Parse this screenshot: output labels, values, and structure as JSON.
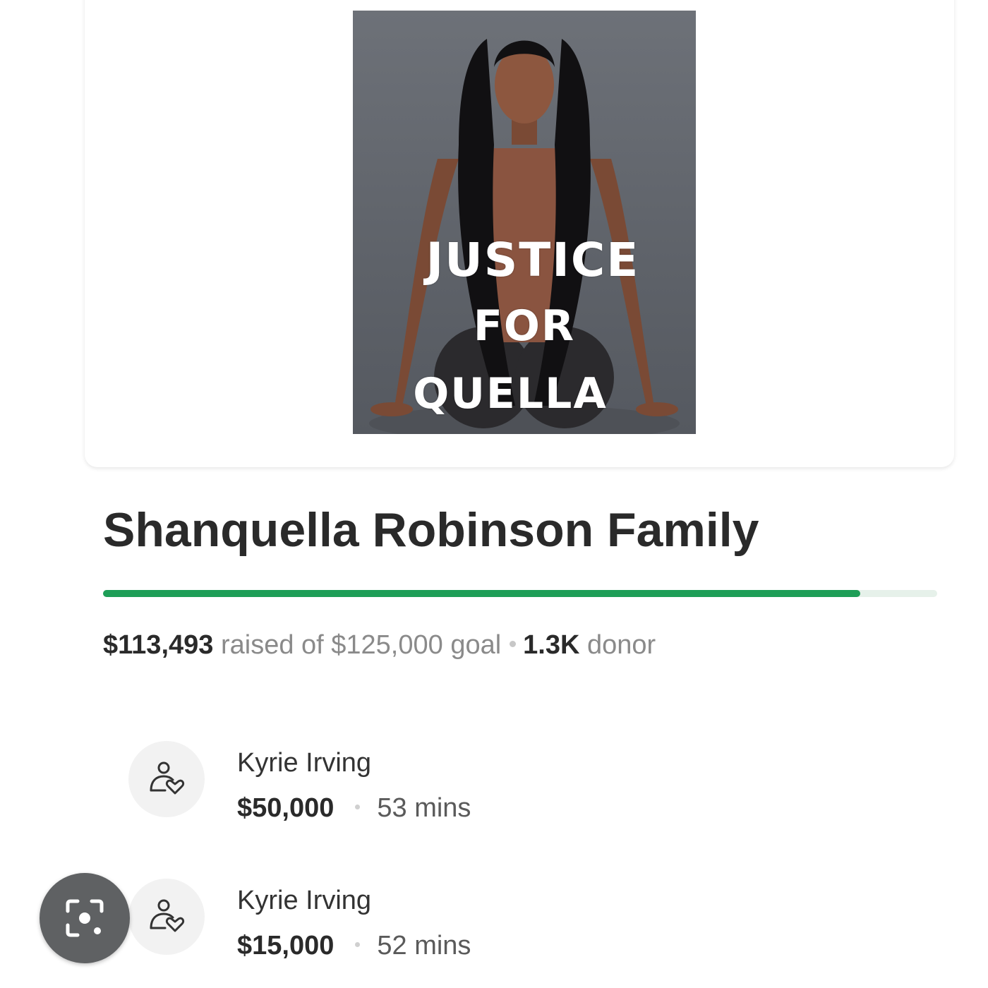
{
  "campaign": {
    "poster": {
      "line_1": "JUSTICE",
      "line_2": "FOR",
      "line_3": "QUELLA"
    },
    "title": "Shanquella Robinson Family",
    "raised_amount": "$113,493",
    "raised_text": "raised of $125,000 goal",
    "donor_count": "1.3K",
    "donor_label": "donor",
    "progress_fraction": 0.908,
    "progress_color": "#1e9e57"
  },
  "donations": [
    {
      "icon": "user-heart-icon",
      "name": "Kyrie Irving",
      "amount": "$50,000",
      "time": "53 mins"
    },
    {
      "icon": "user-heart-icon",
      "name": "Kyrie Irving",
      "amount": "$15,000",
      "time": "52 mins"
    }
  ],
  "overlay": {
    "icon": "image-search-icon"
  }
}
